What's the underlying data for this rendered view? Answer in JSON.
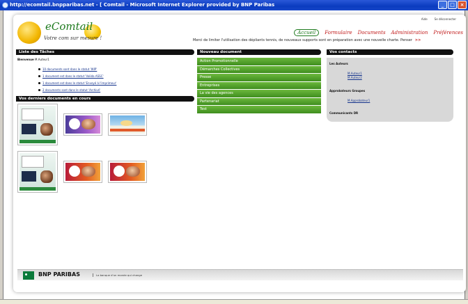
{
  "window": {
    "title": "http://ecomtail.bnpparibas.net - [ Comtail - Microsoft Internet Explorer provided by BNP Paribas"
  },
  "header": {
    "brand": "eComtail",
    "tagline": "Votre com sur mesure !",
    "top_links": [
      "Aide",
      "Se déconnecter"
    ],
    "nav": [
      "Accueil",
      "Formulaire",
      "Documents",
      "Administration",
      "Préférences"
    ],
    "ticker": "Merci de limiter l'utilisation des dépliants tennis, de nouveaux supports sont en préparation avec une nouvelle charte. Penser",
    "ticker_more": ">>"
  },
  "tasks": {
    "title": "Liste des Tâches",
    "user_label": "Bienvenue",
    "user_name": "M.Auteur1",
    "items": [
      "10 documents sont dans le statut 'WIP'",
      "1 document est dans le statut 'Valida ASSC'",
      "1 document est dans le statut 'Envoyé à l'imprimeur'",
      "2 documents sont dans le statut 'Archivé'"
    ]
  },
  "recent_docs": {
    "title": "Vos derniers documents en cours"
  },
  "new_document": {
    "title": "Nouveau document",
    "items": [
      "Action Promotionnelle",
      "Démarches Collectives",
      "Presse",
      "Entreprises",
      "La vie des agences",
      "Partenariat",
      "Test"
    ]
  },
  "contacts": {
    "title": "Vos contacts",
    "authors_label": "Les Auteurs",
    "authors": [
      "M.Auteur1",
      "M.Auteur2"
    ],
    "approvers_label": "Approbateurs Groupes",
    "approvers": [
      "M.Approbateur1"
    ],
    "community_label": "Communicants DR"
  },
  "footer": {
    "brand": "BNP PARIBAS",
    "slogan": "La banque d'un monde qui change"
  },
  "colors": {
    "accent_green": "#3f8e1f",
    "nav_red": "#c01818",
    "brand_green": "#0a7a3a"
  }
}
